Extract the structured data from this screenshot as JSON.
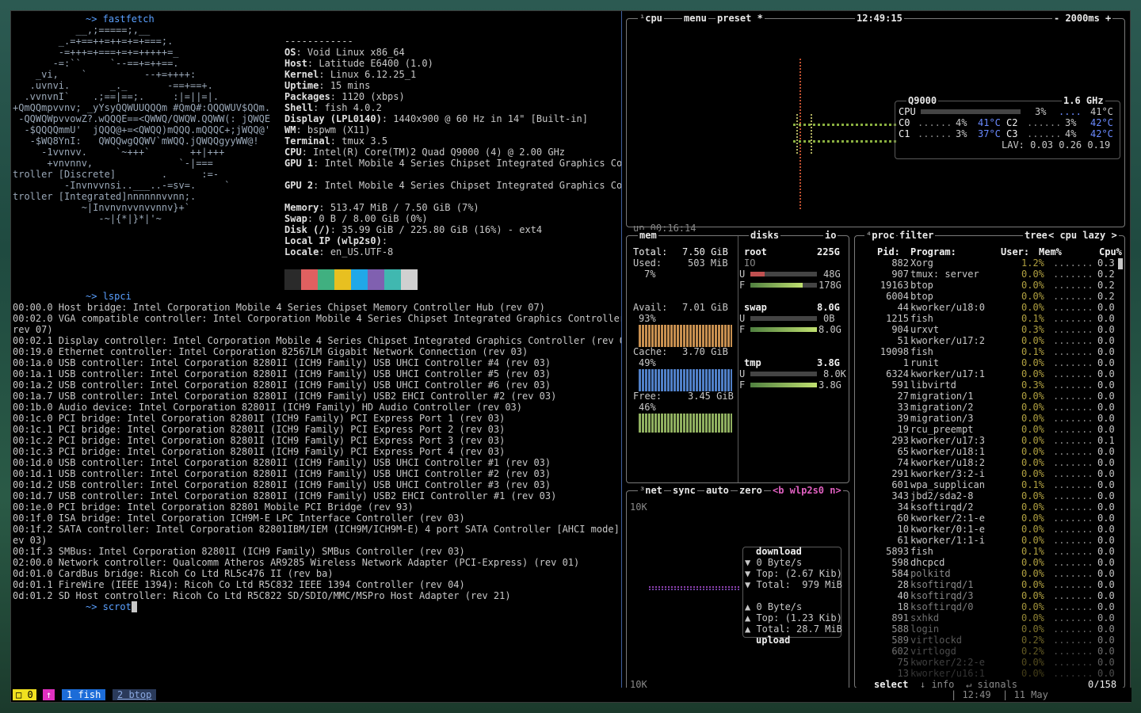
{
  "left_pane": {
    "prompt1": "~> fastfetch",
    "ascii_art": [
      "           __,;=====;,__",
      "        _.=+==++=++=+=+===;.",
      "        -=+++=+===+=+=+++++=_",
      "       -=:``     `--==+=++==.",
      "    _vi,    `          --+=++++:",
      "   .uvnvi.       _._       -==+==+.",
      "  .vvnvnI`    .;==|==;.     :|=||=|.",
      "+QmQQmpvvnv; _yYsyQQWUUQQQm #QmQ#:QQQWUV$QQm.",
      " -QQWQWpvvowZ?.wQQQE==<QWWQ/QWQW.QQWW(: jQWQE",
      "  -$QQQQmmU'  jQQQ@+=<QWQQ)mQQQ.mQQQC+;jWQQ@'",
      "   -$WQ8YnI:   QWQQwgQQWV`mWQQ.jQWQQgyyWW@!",
      "     -1vvnvv.     `~+++`       ++|+++",
      "      +vnvnnv,               `-|===",
      "troller [Discrete]        .      :=-",
      "         -Invnvvnsi..___..-=sv=.     `",
      "troller [Integrated]nnnnnnvvnn;.",
      "            ~|Invnvnvvnvvnnv}+`",
      "               -~|{*|}*|'~"
    ],
    "info_sep": "------------",
    "info": [
      {
        "k": "OS",
        "v": "Void Linux x86_64"
      },
      {
        "k": "Host",
        "v": "Latitude E6400 (1.0)"
      },
      {
        "k": "Kernel",
        "v": "Linux 6.12.25_1"
      },
      {
        "k": "Uptime",
        "v": "15 mins"
      },
      {
        "k": "Packages",
        "v": "1120 (xbps)"
      },
      {
        "k": "Shell",
        "v": "fish 4.0.2"
      },
      {
        "k": "Display (LPL0140)",
        "v": "1440x900 @ 60 Hz in 14\" [Built-in]"
      },
      {
        "k": "WM",
        "v": "bspwm (X11)"
      },
      {
        "k": "Terminal",
        "v": "tmux 3.5"
      },
      {
        "k": "CPU",
        "v": "Intel(R) Core(TM)2 Quad Q9000 (4) @ 2.00 GHz"
      },
      {
        "k": "GPU 1",
        "v": "Intel Mobile 4 Series Chipset Integrated Graphics Con"
      },
      {
        "k": "",
        "v": ""
      },
      {
        "k": "GPU 2",
        "v": "Intel Mobile 4 Series Chipset Integrated Graphics Con"
      },
      {
        "k": "",
        "v": ""
      },
      {
        "k": "Memory",
        "v": "513.47 MiB / 7.50 GiB (7%)"
      },
      {
        "k": "Swap",
        "v": "0 B / 8.00 GiB (0%)"
      },
      {
        "k": "Disk (/)",
        "v": "35.99 GiB / 225.80 GiB (16%) - ext4"
      },
      {
        "k": "Local IP (wlp2s0)",
        "v": ""
      },
      {
        "k": "Locale",
        "v": "en_US.UTF-8"
      }
    ],
    "palette": [
      "#2a2a2a",
      "#e06060",
      "#40b080",
      "#e8c020",
      "#20a8e8",
      "#8060b0",
      "#40b8b0",
      "#d0d0d0"
    ],
    "prompt2": "~> lspci",
    "lspci": [
      "00:00.0 Host bridge: Intel Corporation Mobile 4 Series Chipset Memory Controller Hub (rev 07)",
      "00:02.0 VGA compatible controller: Intel Corporation Mobile 4 Series Chipset Integrated Graphics Controller (",
      "rev 07)",
      "00:02.1 Display controller: Intel Corporation Mobile 4 Series Chipset Integrated Graphics Controller (rev 07)",
      "00:19.0 Ethernet controller: Intel Corporation 82567LM Gigabit Network Connection (rev 03)",
      "00:1a.0 USB controller: Intel Corporation 82801I (ICH9 Family) USB UHCI Controller #4 (rev 03)",
      "00:1a.1 USB controller: Intel Corporation 82801I (ICH9 Family) USB UHCI Controller #5 (rev 03)",
      "00:1a.2 USB controller: Intel Corporation 82801I (ICH9 Family) USB UHCI Controller #6 (rev 03)",
      "00:1a.7 USB controller: Intel Corporation 82801I (ICH9 Family) USB2 EHCI Controller #2 (rev 03)",
      "00:1b.0 Audio device: Intel Corporation 82801I (ICH9 Family) HD Audio Controller (rev 03)",
      "00:1c.0 PCI bridge: Intel Corporation 82801I (ICH9 Family) PCI Express Port 1 (rev 03)",
      "00:1c.1 PCI bridge: Intel Corporation 82801I (ICH9 Family) PCI Express Port 2 (rev 03)",
      "00:1c.2 PCI bridge: Intel Corporation 82801I (ICH9 Family) PCI Express Port 3 (rev 03)",
      "00:1c.3 PCI bridge: Intel Corporation 82801I (ICH9 Family) PCI Express Port 4 (rev 03)",
      "00:1d.0 USB controller: Intel Corporation 82801I (ICH9 Family) USB UHCI Controller #1 (rev 03)",
      "00:1d.1 USB controller: Intel Corporation 82801I (ICH9 Family) USB UHCI Controller #2 (rev 03)",
      "00:1d.2 USB controller: Intel Corporation 82801I (ICH9 Family) USB UHCI Controller #3 (rev 03)",
      "00:1d.7 USB controller: Intel Corporation 82801I (ICH9 Family) USB2 EHCI Controller #1 (rev 03)",
      "00:1e.0 PCI bridge: Intel Corporation 82801 Mobile PCI Bridge (rev 93)",
      "00:1f.0 ISA bridge: Intel Corporation ICH9M-E LPC Interface Controller (rev 03)",
      "00:1f.2 SATA controller: Intel Corporation 82801IBM/IEM (ICH9M/ICH9M-E) 4 port SATA Controller [AHCI mode] (r",
      "ev 03)",
      "00:1f.3 SMBus: Intel Corporation 82801I (ICH9 Family) SMBus Controller (rev 03)",
      "02:00.0 Network controller: Qualcomm Atheros AR9285 Wireless Network Adapter (PCI-Express) (rev 01)",
      "0d:01.0 CardBus bridge: Ricoh Co Ltd RL5c476 II (rev ba)",
      "0d:01.1 FireWire (IEEE 1394): Ricoh Co Ltd R5C832 IEEE 1394 Controller (rev 04)",
      "0d:01.2 SD Host controller: Ricoh Co Ltd R5C822 SD/SDIO/MMC/MSPro Host Adapter (rev 21)"
    ],
    "prompt3": "~> scrot"
  },
  "cpu": {
    "title_num": "¹",
    "title": "cpu",
    "menu": "menu",
    "preset": "preset *",
    "clock": "12:49:15",
    "interval": "- 2000ms +",
    "uptime": "up 00:16:14",
    "model": "Q9000",
    "freq": "1.6 GHz",
    "rows": [
      {
        "name": "CPU",
        "pct": "3%",
        "temp": "41°C"
      },
      {
        "name": "C0",
        "pct": "4%",
        "temp": "41°C",
        "name2": "C2",
        "pct2": "3%",
        "temp2": "42°C"
      },
      {
        "name": "C1",
        "pct": "3%",
        "temp": "37°C",
        "name2": "C3",
        "pct2": "4%",
        "temp2": "42°C"
      }
    ],
    "lav": "LAV: 0.03 0.26 0.19"
  },
  "mem": {
    "title": "mem",
    "total_label": "Total:",
    "total": "7.50 GiB",
    "used_label": "Used:",
    "used": "503 MiB",
    "used_pct": "7%",
    "avail_label": "Avail:",
    "avail": "7.01 GiB",
    "avail_pct": "93%",
    "cache_label": "Cache:",
    "cache": "3.70 GiB",
    "cache_pct": "49%",
    "free_label": "Free:",
    "free": "3.45 GiB",
    "free_pct": "46%"
  },
  "disks": {
    "title": "disks",
    "io": "io",
    "items": [
      {
        "name": "root",
        "size": "225G",
        "io": "IO",
        "used": "48G",
        "free": "178G",
        "used_frac": 0.21
      },
      {
        "name": "swap",
        "size": "8.0G",
        "used": "0B",
        "free": "8.0G",
        "used_frac": 0.0
      },
      {
        "name": "tmp",
        "size": "3.8G",
        "used": "8.0K",
        "free": "3.8G",
        "used_frac": 0.0
      }
    ]
  },
  "net": {
    "title": "net",
    "sync": "sync",
    "auto": "auto",
    "zero": "zero",
    "iface": "<b wlp2s0 n>",
    "scale_top": "10K",
    "scale_bottom": "10K",
    "download": "download",
    "dl_rate": "0 Byte/s",
    "dl_top": "Top: (2.67 Kib)",
    "dl_total": "Total:  979 MiB",
    "ul_rate": "0 Byte/s",
    "ul_top": "Top: (1.23 Kib)",
    "ul_total": "Total: 28.7 MiB",
    "upload": "upload"
  },
  "proc": {
    "title": "proc",
    "filter": "filter",
    "tree": "tree",
    "sort": "< cpu lazy >",
    "headers": {
      "pid": "Pid:",
      "program": "Program:",
      "user": "User:",
      "mem": "Mem%",
      "cpu": "Cpu%"
    },
    "rows": [
      {
        "pid": "882",
        "prog": "Xorg",
        "mem": "1.2%",
        "cpu": "0.3"
      },
      {
        "pid": "907",
        "prog": "tmux: server",
        "mem": "0.0%",
        "cpu": "0.2"
      },
      {
        "pid": "19163",
        "prog": "btop",
        "mem": "0.0%",
        "cpu": "0.2"
      },
      {
        "pid": "6004",
        "prog": "btop",
        "mem": "0.0%",
        "cpu": "0.2"
      },
      {
        "pid": "44",
        "prog": "kworker/u18:0",
        "mem": "0.0%",
        "cpu": "0.0"
      },
      {
        "pid": "1215",
        "prog": "fish",
        "mem": "0.1%",
        "cpu": "0.0"
      },
      {
        "pid": "904",
        "prog": "urxvt",
        "mem": "0.3%",
        "cpu": "0.0"
      },
      {
        "pid": "51",
        "prog": "kworker/u17:2",
        "mem": "0.0%",
        "cpu": "0.0"
      },
      {
        "pid": "19098",
        "prog": "fish",
        "mem": "0.1%",
        "cpu": "0.0"
      },
      {
        "pid": "1",
        "prog": "runit",
        "mem": "0.0%",
        "cpu": "0.0"
      },
      {
        "pid": "6324",
        "prog": "kworker/u17:1",
        "mem": "0.0%",
        "cpu": "0.0"
      },
      {
        "pid": "591",
        "prog": "libvirtd",
        "mem": "0.3%",
        "cpu": "0.0"
      },
      {
        "pid": "27",
        "prog": "migration/1",
        "mem": "0.0%",
        "cpu": "0.0"
      },
      {
        "pid": "33",
        "prog": "migration/2",
        "mem": "0.0%",
        "cpu": "0.0"
      },
      {
        "pid": "39",
        "prog": "migration/3",
        "mem": "0.0%",
        "cpu": "0.0"
      },
      {
        "pid": "19",
        "prog": "rcu_preempt",
        "mem": "0.0%",
        "cpu": "0.0"
      },
      {
        "pid": "293",
        "prog": "kworker/u17:3",
        "mem": "0.0%",
        "cpu": "0.1"
      },
      {
        "pid": "65",
        "prog": "kworker/u18:1",
        "mem": "0.0%",
        "cpu": "0.0"
      },
      {
        "pid": "74",
        "prog": "kworker/u18:2",
        "mem": "0.0%",
        "cpu": "0.0"
      },
      {
        "pid": "291",
        "prog": "kworker/3:2-i",
        "mem": "0.0%",
        "cpu": "0.0"
      },
      {
        "pid": "601",
        "prog": "wpa_supplican",
        "mem": "0.1%",
        "cpu": "0.0"
      },
      {
        "pid": "343",
        "prog": "jbd2/sda2-8",
        "mem": "0.0%",
        "cpu": "0.0"
      },
      {
        "pid": "34",
        "prog": "ksoftirqd/2",
        "mem": "0.0%",
        "cpu": "0.0"
      },
      {
        "pid": "60",
        "prog": "kworker/2:1-e",
        "mem": "0.0%",
        "cpu": "0.0"
      },
      {
        "pid": "10",
        "prog": "kworker/0:1-e",
        "mem": "0.0%",
        "cpu": "0.0"
      },
      {
        "pid": "61",
        "prog": "kworker/1:1-i",
        "mem": "0.0%",
        "cpu": "0.0"
      },
      {
        "pid": "5893",
        "prog": "fish",
        "mem": "0.1%",
        "cpu": "0.0"
      },
      {
        "pid": "598",
        "prog": "dhcpcd",
        "mem": "0.0%",
        "cpu": "0.0"
      },
      {
        "pid": "584",
        "prog": "polkitd",
        "mem": "0.0%",
        "cpu": "0.0"
      },
      {
        "pid": "28",
        "prog": "ksoftirqd/1",
        "mem": "0.0%",
        "cpu": "0.0"
      },
      {
        "pid": "40",
        "prog": "ksoftirqd/3",
        "mem": "0.0%",
        "cpu": "0.0"
      },
      {
        "pid": "18",
        "prog": "ksoftirqd/0",
        "mem": "0.0%",
        "cpu": "0.0"
      },
      {
        "pid": "891",
        "prog": "sxhkd",
        "mem": "0.0%",
        "cpu": "0.0"
      },
      {
        "pid": "588",
        "prog": "login",
        "mem": "0.0%",
        "cpu": "0.0"
      },
      {
        "pid": "589",
        "prog": "virtlockd",
        "mem": "0.2%",
        "cpu": "0.0"
      },
      {
        "pid": "602",
        "prog": "virtlogd",
        "mem": "0.2%",
        "cpu": "0.0"
      },
      {
        "pid": "75",
        "prog": "kworker/2:2-e",
        "mem": "0.0%",
        "cpu": "0.0"
      },
      {
        "pid": "13",
        "prog": "kworker/u16:1",
        "mem": "0.0%",
        "cpu": "0.0"
      }
    ],
    "select": "select",
    "info": "info",
    "signals": "signals",
    "count": "0/158"
  },
  "statusbar": {
    "session": "0",
    "mark": "↑",
    "win1": "1 fish",
    "win2": "2 btop",
    "time": "12:49",
    "date": "11 May"
  },
  "colors": {
    "accent_blue": "#1c6cd8",
    "session_yellow": "#f0e020",
    "mark_magenta": "#e030c0",
    "box_border": "#7a7a7a"
  }
}
